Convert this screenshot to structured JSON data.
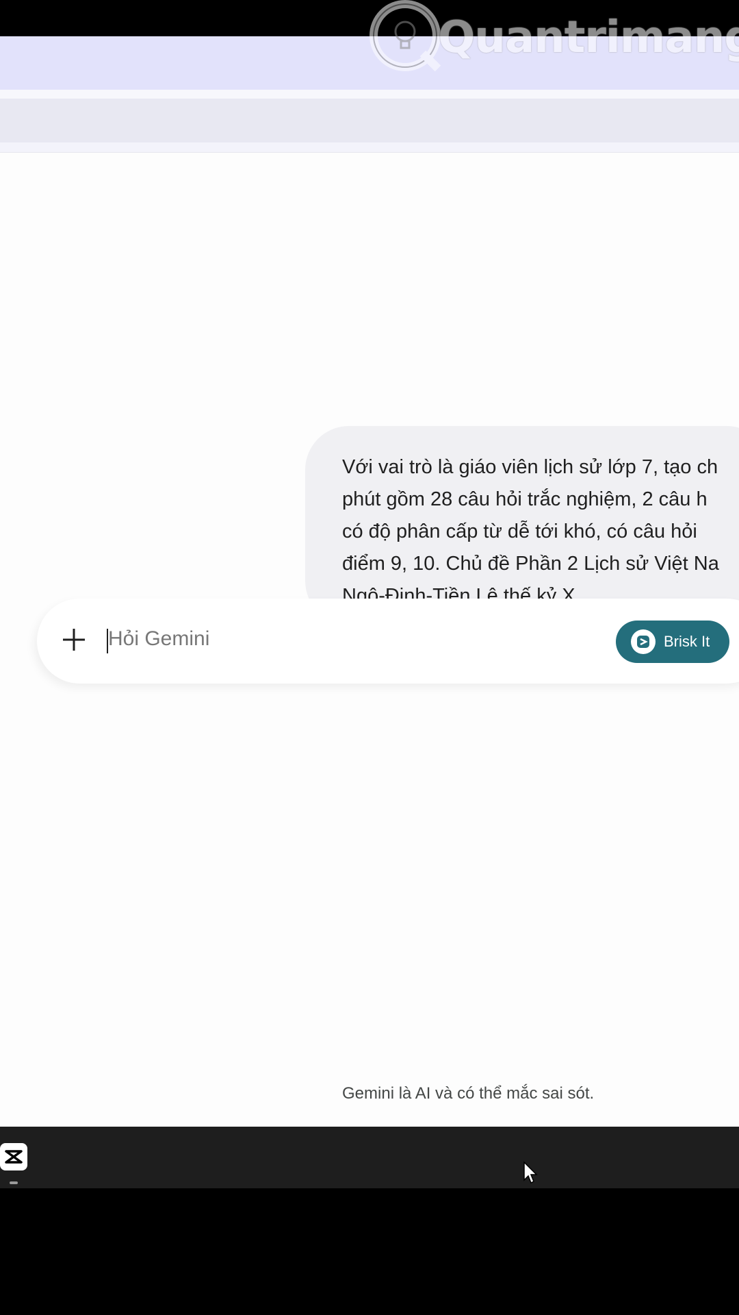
{
  "watermark": {
    "brand": "Quantrimang"
  },
  "chat": {
    "user_message_lines": [
      "Với vai trò là giáo viên lịch sử lớp 7, tạo ch",
      "phút gồm 28 câu hỏi trắc nghiệm, 2 câu h",
      "có độ phân cấp từ dễ tới khó, có câu hỏi",
      "điểm 9, 10. Chủ đề Phần 2 Lịch sử Việt Na",
      "Ngô-Đinh-Tiền Lê thế kỷ X"
    ]
  },
  "input": {
    "placeholder": "Hỏi Gemini",
    "add_icon": "plus-icon",
    "brisk_label": "Brisk It",
    "brisk_icon": "brisk-logo-icon"
  },
  "footer": {
    "disclaimer": "Gemini là AI và có thể mắc sai sót."
  },
  "taskbar": {
    "app_icon": "capcut-icon"
  },
  "colors": {
    "accent_button": "#246e7c",
    "bubble": "#f0f0f3",
    "header_band": "#e2e2fb"
  }
}
